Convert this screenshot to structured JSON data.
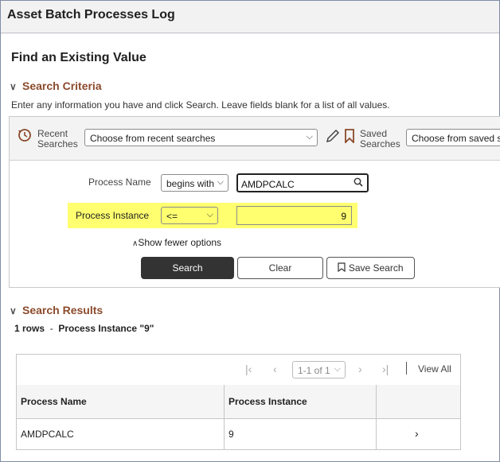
{
  "window": {
    "title": "Asset Batch Processes Log"
  },
  "page": {
    "heading": "Find an Existing Value",
    "search_criteria_label": "Search Criteria",
    "hint": "Enter any information you have and click Search. Leave fields blank for a list of all values."
  },
  "recent": {
    "label_line1": "Recent",
    "label_line2": "Searches",
    "select_value": "Choose from recent searches"
  },
  "saved": {
    "label_line1": "Saved",
    "label_line2": "Searches",
    "select_value": "Choose from saved s"
  },
  "fields": {
    "process_name": {
      "label": "Process Name",
      "operator": "begins with",
      "value": "AMDPCALC"
    },
    "process_instance": {
      "label": "Process Instance",
      "operator": "<=",
      "value": "9"
    }
  },
  "show_fewer": "Show fewer options",
  "buttons": {
    "search": "Search",
    "clear": "Clear",
    "save_search": "Save Search"
  },
  "results": {
    "label": "Search Results",
    "count": "1 rows",
    "separator": "-",
    "criteria": "Process Instance \"9\"",
    "pager_select": "1-1 of 1",
    "view_all": "View All",
    "columns": [
      "Process Name",
      "Process Instance"
    ],
    "rows": [
      {
        "process_name": "AMDPCALC",
        "process_instance": "9"
      }
    ]
  },
  "colors": {
    "accent": "#8b4a2b",
    "highlight": "#ffff70",
    "primary_button": "#333333"
  }
}
